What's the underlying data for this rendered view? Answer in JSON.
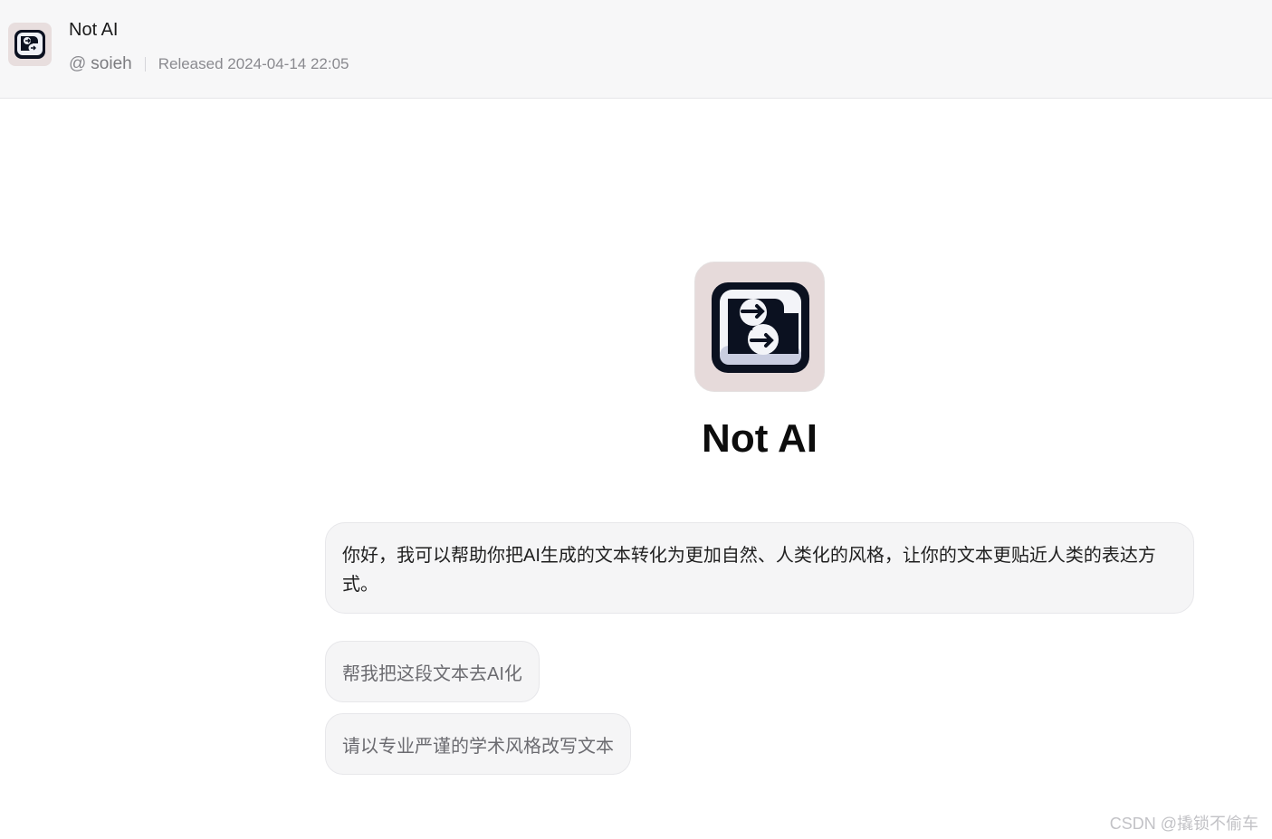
{
  "header": {
    "bot_title": "Not AI",
    "author_prefix": "@",
    "author": "soieh",
    "released": "Released 2024-04-14 22:05",
    "avatar_icon": "bot-logo-icon"
  },
  "bot": {
    "name": "Not AI",
    "logo_icon": "bot-logo-icon",
    "greeting": "你好，我可以帮助你把AI生成的文本转化为更加自然、人类化的风格，让你的文本更贴近人类的表达方式。"
  },
  "suggestions": [
    {
      "label": "帮我把这段文本去AI化"
    },
    {
      "label": "请以专业严谨的学术风格改写文本"
    }
  ],
  "watermark": "CSDN @撬锁不偷车",
  "colors": {
    "header_bg": "#f7f7f8",
    "bubble_bg": "#f5f5f6",
    "logo_bg": "#e6dada",
    "logo_dark": "#0b1120"
  }
}
